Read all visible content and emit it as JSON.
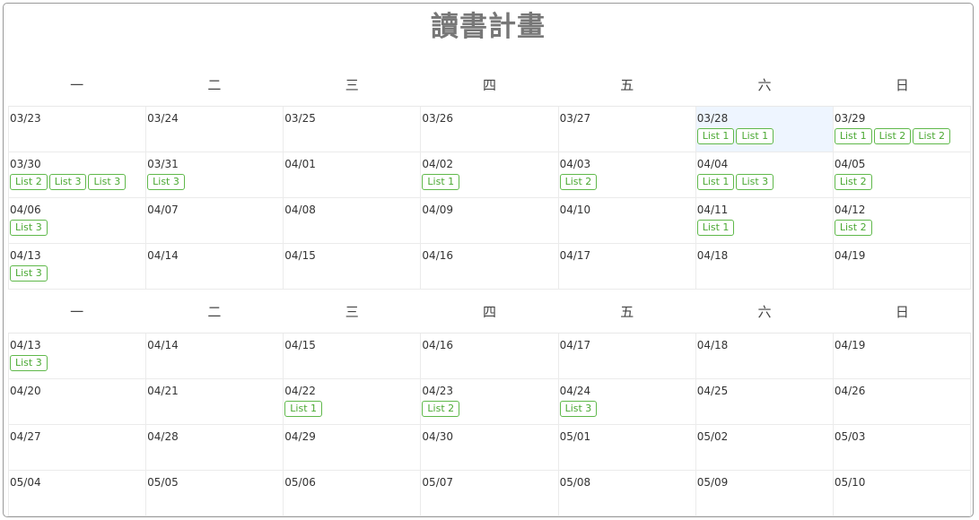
{
  "title": "讀書計畫",
  "weekdays": [
    "一",
    "二",
    "三",
    "四",
    "五",
    "六",
    "日"
  ],
  "calendars": [
    {
      "weeks": [
        [
          {
            "date": "03/23",
            "tags": []
          },
          {
            "date": "03/24",
            "tags": []
          },
          {
            "date": "03/25",
            "tags": []
          },
          {
            "date": "03/26",
            "tags": []
          },
          {
            "date": "03/27",
            "tags": []
          },
          {
            "date": "03/28",
            "tags": [
              "List 1",
              "List 1"
            ],
            "highlight": true
          },
          {
            "date": "03/29",
            "tags": [
              "List 1",
              "List 2",
              "List 2"
            ]
          }
        ],
        [
          {
            "date": "03/30",
            "tags": [
              "List 2",
              "List 3",
              "List 3"
            ]
          },
          {
            "date": "03/31",
            "tags": [
              "List 3"
            ]
          },
          {
            "date": "04/01",
            "tags": []
          },
          {
            "date": "04/02",
            "tags": [
              "List 1"
            ]
          },
          {
            "date": "04/03",
            "tags": [
              "List 2"
            ]
          },
          {
            "date": "04/04",
            "tags": [
              "List 1",
              "List 3"
            ]
          },
          {
            "date": "04/05",
            "tags": [
              "List 2"
            ]
          }
        ],
        [
          {
            "date": "04/06",
            "tags": [
              "List 3"
            ]
          },
          {
            "date": "04/07",
            "tags": []
          },
          {
            "date": "04/08",
            "tags": []
          },
          {
            "date": "04/09",
            "tags": []
          },
          {
            "date": "04/10",
            "tags": []
          },
          {
            "date": "04/11",
            "tags": [
              "List 1"
            ]
          },
          {
            "date": "04/12",
            "tags": [
              "List 2"
            ]
          }
        ],
        [
          {
            "date": "04/13",
            "tags": [
              "List 3"
            ]
          },
          {
            "date": "04/14",
            "tags": []
          },
          {
            "date": "04/15",
            "tags": []
          },
          {
            "date": "04/16",
            "tags": []
          },
          {
            "date": "04/17",
            "tags": []
          },
          {
            "date": "04/18",
            "tags": []
          },
          {
            "date": "04/19",
            "tags": []
          }
        ]
      ]
    },
    {
      "weeks": [
        [
          {
            "date": "04/13",
            "tags": [
              "List 3"
            ]
          },
          {
            "date": "04/14",
            "tags": []
          },
          {
            "date": "04/15",
            "tags": []
          },
          {
            "date": "04/16",
            "tags": []
          },
          {
            "date": "04/17",
            "tags": []
          },
          {
            "date": "04/18",
            "tags": []
          },
          {
            "date": "04/19",
            "tags": []
          }
        ],
        [
          {
            "date": "04/20",
            "tags": []
          },
          {
            "date": "04/21",
            "tags": []
          },
          {
            "date": "04/22",
            "tags": [
              "List 1"
            ]
          },
          {
            "date": "04/23",
            "tags": [
              "List 2"
            ]
          },
          {
            "date": "04/24",
            "tags": [
              "List 3"
            ]
          },
          {
            "date": "04/25",
            "tags": []
          },
          {
            "date": "04/26",
            "tags": []
          }
        ],
        [
          {
            "date": "04/27",
            "tags": []
          },
          {
            "date": "04/28",
            "tags": []
          },
          {
            "date": "04/29",
            "tags": []
          },
          {
            "date": "04/30",
            "tags": []
          },
          {
            "date": "05/01",
            "tags": []
          },
          {
            "date": "05/02",
            "tags": []
          },
          {
            "date": "05/03",
            "tags": []
          }
        ],
        [
          {
            "date": "05/04",
            "tags": []
          },
          {
            "date": "05/05",
            "tags": []
          },
          {
            "date": "05/06",
            "tags": []
          },
          {
            "date": "05/07",
            "tags": []
          },
          {
            "date": "05/08",
            "tags": []
          },
          {
            "date": "05/09",
            "tags": []
          },
          {
            "date": "05/10",
            "tags": []
          }
        ]
      ]
    }
  ],
  "colors": {
    "title": "#777777",
    "tag_border": "#5fb84a",
    "tag_text": "#4aa832",
    "highlight_bg": "#eef5ff",
    "grid_line": "#ebebeb"
  }
}
